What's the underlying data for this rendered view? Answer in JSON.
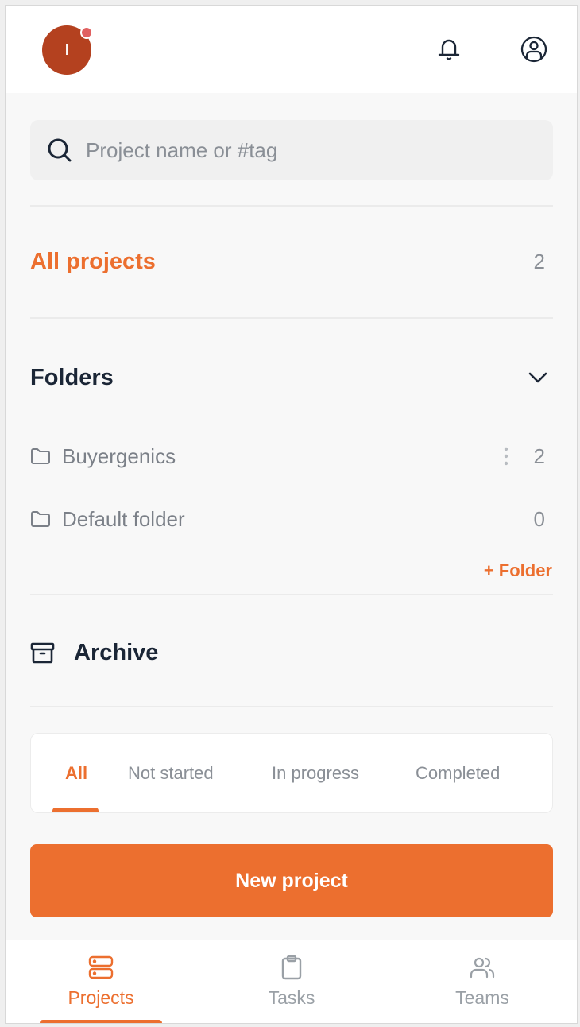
{
  "header": {
    "avatar_initial": "I",
    "notification_dot": true,
    "icons": [
      "bell-icon",
      "user-circle-icon"
    ]
  },
  "search": {
    "placeholder": "Project name or #tag",
    "value": ""
  },
  "all_projects": {
    "label": "All projects",
    "count": "2"
  },
  "folders": {
    "label": "Folders",
    "expanded": true,
    "items": [
      {
        "name": "Buyergenics",
        "count": "2",
        "has_menu": true
      },
      {
        "name": "Default folder",
        "count": "0",
        "has_menu": false
      }
    ],
    "add_label": "+ Folder"
  },
  "archive": {
    "label": "Archive"
  },
  "status_tabs": {
    "items": [
      {
        "label": "All",
        "active": true
      },
      {
        "label": "Not started",
        "active": false
      },
      {
        "label": "In progress",
        "active": false
      },
      {
        "label": "Completed",
        "active": false
      }
    ]
  },
  "new_project_button": {
    "label": "New project"
  },
  "bottom_nav": {
    "items": [
      {
        "label": "Projects",
        "icon": "server-icon",
        "active": true
      },
      {
        "label": "Tasks",
        "icon": "clipboard-icon",
        "active": false
      },
      {
        "label": "Teams",
        "icon": "users-icon",
        "active": false
      }
    ]
  },
  "colors": {
    "accent": "#ec6f2f",
    "avatar": "#b4411f",
    "notification_dot": "#e06060",
    "text_dark": "#1b2636",
    "text_muted": "#8a8f96"
  }
}
